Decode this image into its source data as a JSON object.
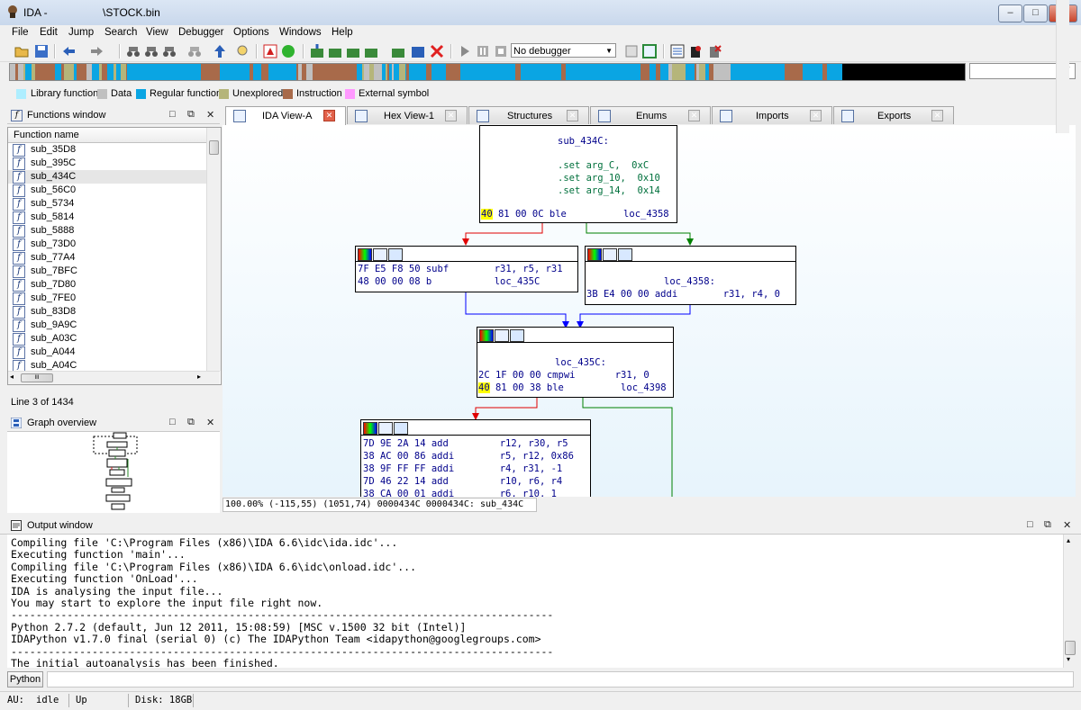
{
  "window": {
    "title_app": "IDA - ",
    "title_file": "\\STOCK.bin",
    "minimize": "–",
    "maximize": "□",
    "close": "x"
  },
  "menu": [
    "File",
    "Edit",
    "Jump",
    "Search",
    "View",
    "Debugger",
    "Options",
    "Windows",
    "Help"
  ],
  "toolbar": {
    "debugger_value": "No debugger",
    "dropdown_arrow": "▼"
  },
  "legend": [
    {
      "label": "Library function",
      "color": "#aeeeff"
    },
    {
      "label": "Data",
      "color": "#c0c0c0"
    },
    {
      "label": "Regular function",
      "color": "#0aa5e3"
    },
    {
      "label": "Unexplored",
      "color": "#b5b57a"
    },
    {
      "label": "Instruction",
      "color": "#a86a4a"
    },
    {
      "label": "External symbol",
      "color": "#ff99ff"
    }
  ],
  "functions_window": {
    "title": "Functions window",
    "column_header": "Function name",
    "icon_glyph": "f",
    "items": [
      "sub_35D8",
      "sub_395C",
      "sub_434C",
      "sub_56C0",
      "sub_5734",
      "sub_5814",
      "sub_5888",
      "sub_73D0",
      "sub_77A4",
      "sub_7BFC",
      "sub_7D80",
      "sub_7FE0",
      "sub_83D8",
      "sub_9A9C",
      "sub_A03C",
      "sub_A044",
      "sub_A04C"
    ],
    "selected_index": 2,
    "status": "Line 3 of 1434",
    "hscroll_glyph": "III"
  },
  "graph_overview": {
    "title": "Graph overview"
  },
  "panel_buttons": {
    "restore": "□",
    "float": "⧉",
    "close": "✕"
  },
  "tabs": [
    {
      "label": "IDA View-A",
      "active": true
    },
    {
      "label": "Hex View-1",
      "active": false
    },
    {
      "label": "Structures",
      "active": false
    },
    {
      "label": "Enums",
      "active": false
    },
    {
      "label": "Imports",
      "active": false
    },
    {
      "label": "Exports",
      "active": false
    }
  ],
  "graph": {
    "node1": {
      "title": "sub_434C:",
      "set1": ".set arg_C,  0xC",
      "set2": ".set arg_10,  0x10",
      "set3": ".set arg_14,  0x14",
      "branch_hl": "40",
      "branch_rest": " 81 00 0C ble          loc_4358"
    },
    "node2": {
      "line1": "7F E5 F8 50 subf        r31, r5, r31",
      "line2": "48 00 00 08 b           loc_435C"
    },
    "node3": {
      "title": "loc_4358:",
      "line1": "3B E4 00 00 addi        r31, r4, 0"
    },
    "node4": {
      "title": "loc_435C:",
      "line1": "2C 1F 00 00 cmpwi       r31, 0",
      "branch_hl": "40",
      "branch_rest": " 81 00 38 ble          loc_4398"
    },
    "node5": {
      "line1": "7D 9E 2A 14 add         r12, r30, r5",
      "line2": "38 AC 00 86 addi        r5, r12, 0x86",
      "line3": "38 9F FF FF addi        r4, r31, -1",
      "line4": "7D 46 22 14 add         r10, r6, r4",
      "line5": "38 CA 00 01 addi        r6, r10, 1"
    },
    "status": "100.00% (-115,55) (1051,74) 0000434C 0000434C: sub_434C"
  },
  "output_window": {
    "title": "Output window",
    "lines": [
      "Compiling file 'C:\\Program Files (x86)\\IDA 6.6\\idc\\ida.idc'...",
      "Executing function 'main'...",
      "Compiling file 'C:\\Program Files (x86)\\IDA 6.6\\idc\\onload.idc'...",
      "Executing function 'OnLoad'...",
      "IDA is analysing the input file...",
      "You may start to explore the input file right now.",
      "---------------------------------------------------------------------------------------",
      "Python 2.7.2 (default, Jun 12 2011, 15:08:59) [MSC v.1500 32 bit (Intel)]",
      "IDAPython v1.7.0 final (serial 0) (c) The IDAPython Team <idapython@googlegroups.com>",
      "---------------------------------------------------------------------------------------",
      "The initial autoanalysis has been finished."
    ],
    "python_button": "Python"
  },
  "statusbar": {
    "au_label": "AU:",
    "au_state": "idle",
    "direction": "Up",
    "disk": "Disk: 18GB"
  },
  "colors": {
    "branch_true": "#00a000",
    "branch_false": "#e00000",
    "flow": "#0000ff",
    "highlight": "#ffff00"
  }
}
